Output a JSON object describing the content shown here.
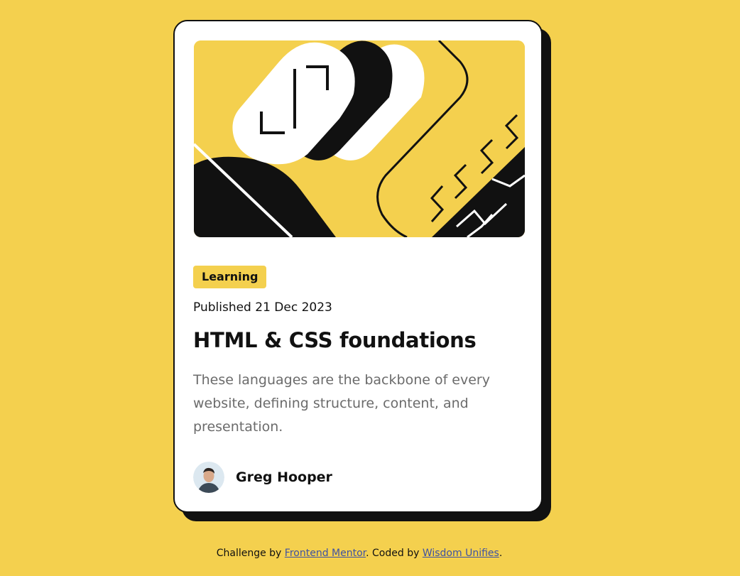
{
  "card": {
    "tag": "Learning",
    "published": "Published 21 Dec 2023",
    "title": "HTML & CSS foundations",
    "description": "These languages are the backbone of every website, defining structure, content, and presentation.",
    "author": "Greg Hooper",
    "hero_icon": "abstract-illustration",
    "avatar_icon": "author-avatar"
  },
  "attribution": {
    "prefix": "Challenge by ",
    "link1": "Frontend Mentor",
    "middle": ". Coded by ",
    "link2": "Wisdom Unifies",
    "suffix": "."
  },
  "colors": {
    "background": "#F4D04E",
    "card": "#FFFFFF",
    "ink": "#111111",
    "muted": "#6B6B6B",
    "link": "#3E52A3"
  }
}
